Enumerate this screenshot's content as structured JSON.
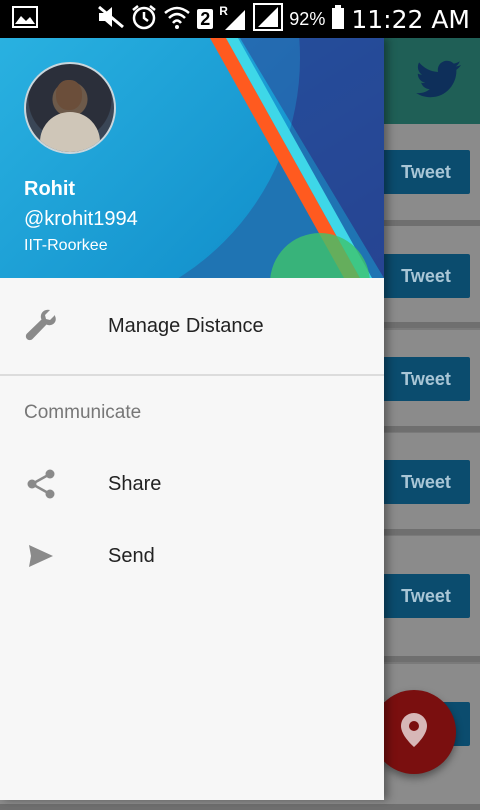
{
  "status_bar": {
    "sim_slot": "2",
    "roaming": "R",
    "battery": "92%",
    "time": "11:22 AM"
  },
  "app": {
    "tweet_buttons": [
      "Tweet",
      "Tweet",
      "Tweet",
      "Tweet",
      "Tweet"
    ]
  },
  "drawer": {
    "user": {
      "name": "Rohit",
      "handle": "@krohit1994",
      "org": "IIT-Roorkee"
    },
    "items": [
      {
        "label": "Manage Distance",
        "icon": "wrench-icon"
      },
      {
        "label": "Share",
        "icon": "share-icon"
      },
      {
        "label": "Send",
        "icon": "send-icon"
      }
    ],
    "section_title": "Communicate"
  },
  "colors": {
    "toolbar": "#1f5f56",
    "tweet_button": "#0b4c6e",
    "fab": "#7a0f0f",
    "drawer_bg": "#f7f7f7"
  }
}
